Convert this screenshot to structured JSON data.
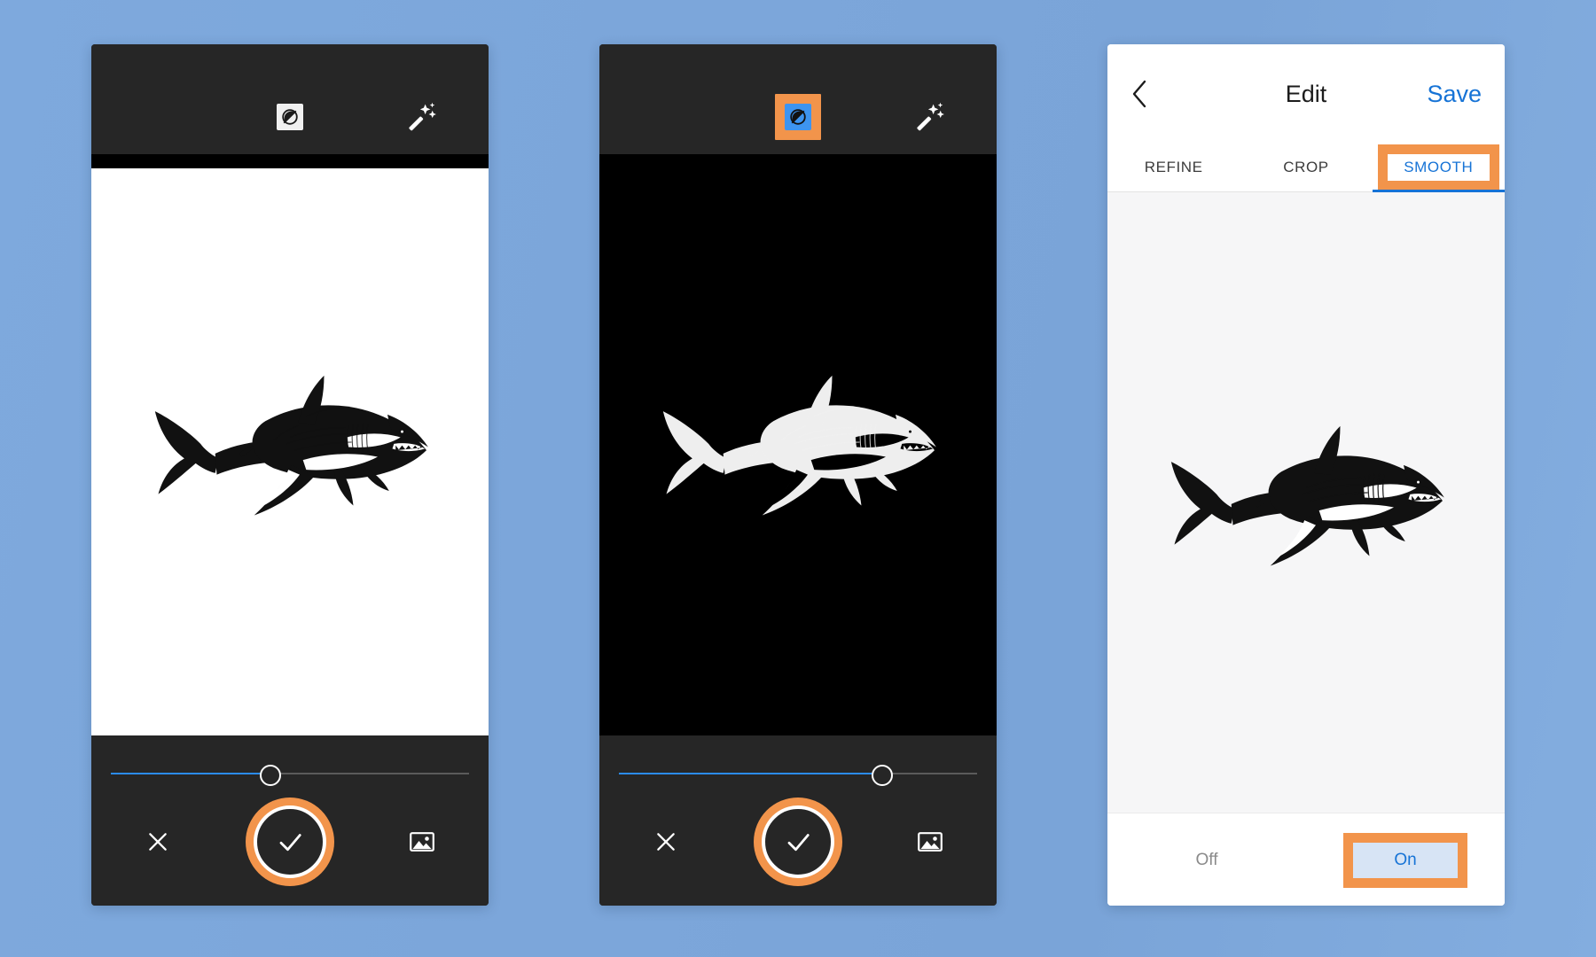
{
  "background": {
    "color": "#7ba7dc"
  },
  "accents": {
    "highlight_orange": "#f2944b",
    "active_blue": "#1673d6",
    "slider_blue": "#2b8bf0",
    "selected_bg": "#d7e4f5"
  },
  "panels": [
    {
      "id": "panel-capture-original",
      "topbar": {
        "invert_icon": "invert-icon",
        "invert_active": false,
        "invert_highlighted": false,
        "wand_icon": "magic-wand-icon"
      },
      "canvas": {
        "background": "white",
        "image": "shark-illustration",
        "inverted": false
      },
      "slider": {
        "value_percent": 44,
        "fill_color": "#2b8bf0"
      },
      "actions": {
        "close_icon": "close-icon",
        "confirm_icon": "check-icon",
        "confirm_highlighted": true,
        "gallery_icon": "gallery-icon"
      }
    },
    {
      "id": "panel-capture-inverted",
      "topbar": {
        "invert_icon": "invert-icon",
        "invert_active": true,
        "invert_highlighted": true,
        "wand_icon": "magic-wand-icon"
      },
      "canvas": {
        "background": "black",
        "image": "shark-illustration",
        "inverted": true
      },
      "slider": {
        "value_percent": 73,
        "fill_color": "#2b8bf0"
      },
      "actions": {
        "close_icon": "close-icon",
        "confirm_icon": "check-icon",
        "confirm_highlighted": true,
        "gallery_icon": "gallery-icon"
      }
    }
  ],
  "edit_panel": {
    "id": "panel-edit",
    "header": {
      "back_icon": "back-chevron-icon",
      "title": "Edit",
      "save_label": "Save"
    },
    "tabs": [
      {
        "label": "REFINE",
        "active": false,
        "highlighted": false
      },
      {
        "label": "CROP",
        "active": false,
        "highlighted": false
      },
      {
        "label": "SMOOTH",
        "active": true,
        "highlighted": true
      }
    ],
    "canvas": {
      "background": "#f6f6f7",
      "image": "shark-illustration",
      "inverted": false
    },
    "footer": {
      "options": [
        {
          "label": "Off",
          "selected": false,
          "highlighted": false
        },
        {
          "label": "On",
          "selected": true,
          "highlighted": true
        }
      ]
    }
  }
}
